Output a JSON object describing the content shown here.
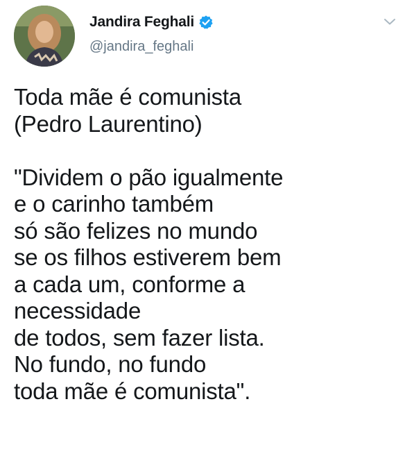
{
  "tweet": {
    "author": {
      "display_name": "Jandira Feghali",
      "handle": "@jandira_feghali",
      "verified_icon": "verified-badge-icon",
      "avatar": "avatar"
    },
    "menu_icon": "chevron-down-icon",
    "text": "Toda mãe é comunista\n(Pedro Laurentino)\n\n\"Dividem o pão igualmente\ne o carinho também\nsó são felizes no mundo\nse os filhos estiverem bem\na cada um, conforme a\nnecessidade\nde todos, sem fazer lista.\nNo fundo, no fundo\ntoda mãe é comunista\"."
  },
  "colors": {
    "text": "#14171a",
    "secondary_text": "#657786",
    "verified_blue": "#1da1f2",
    "background": "#ffffff"
  }
}
